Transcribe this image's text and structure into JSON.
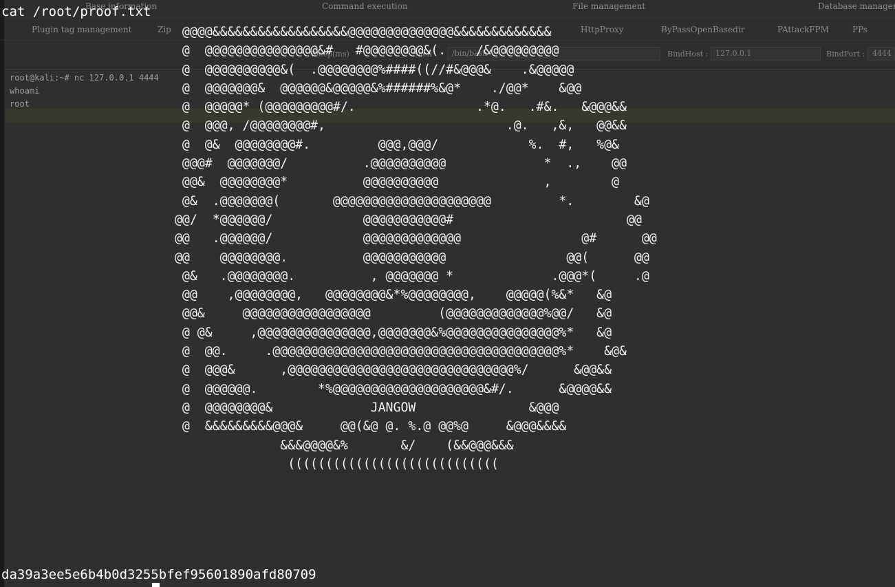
{
  "nav": {
    "row1": [
      "Base information",
      "Command execution",
      "File management",
      "Database management"
    ],
    "row2": [
      "Plugin tag management",
      "Zip",
      "HttpProxy",
      "ByPassOpenBasedir",
      "PAttackFPM",
      "PPs"
    ]
  },
  "options": {
    "sleep_label": "Sleep(ms)",
    "shell_label": "Shell",
    "shell_value": "/bin/bash",
    "bindhost_label": "BindHost :",
    "bindhost_value": "127.0.0.1",
    "bindport_label": "BindPort :",
    "bindport_value": "4444"
  },
  "console": {
    "lines": [
      "root@kali:~# nc 127.0.0.1 4444",
      "whoami",
      "root"
    ]
  },
  "terminal": {
    "command": "cat /root/proof.txt",
    "ascii_art": "  @@@@&&&&&&&&&&&&&&&&&&@@@@@@@@@@@@@@&&&&&&&&&&&&&\n  @  @@@@@@@@@@@@@@@&#   #@@@@@@@@&(.    /&@@@@@@@@@\n  @  @@@@@@@@@@&(  .@@@@@@@@%####((//#&@@@&    .&@@@@@\n  @  @@@@@@@&  @@@@@@&@@@@@&%######%&@*    ./@@*    &@@\n  @  @@@@@* (@@@@@@@@@#/.                .*@.   .#&.   &@@@&&\n  @  @@@, /@@@@@@@@#,                        .@.   ,&,   @@&&\n  @  @&  @@@@@@@@#.         @@@,@@@/            %.  #,   %@&\n  @@@#  @@@@@@@/          .@@@@@@@@@@             *  .,    @@\n  @@&  @@@@@@@@*          @@@@@@@@@@              ,        @\n  @&  .@@@@@@@(       @@@@@@@@@@@@@@@@@@@@@         *.        &@\n @@/  *@@@@@@/            @@@@@@@@@@@#                       @@\n @@   .@@@@@@/            @@@@@@@@@@@@@                @#      @@\n @@    @@@@@@@@.          @@@@@@@@@@@                @@(      @@\n  @&   .@@@@@@@@.          , @@@@@@@ *             .@@@*(     .@\n  @@    ,@@@@@@@@,   @@@@@@@@&*%@@@@@@@@,    @@@@@(%&*   &@\n  @@&     @@@@@@@@@@@@@@@@@         (@@@@@@@@@@@@@%@@/   &@\n  @ @&     ,@@@@@@@@@@@@@@@,@@@@@@@&%@@@@@@@@@@@@@@@%*   &@\n  @  @@.     .@@@@@@@@@@@@@@@@@@@@@@@@@@@@@@@@@@@@@@%*    &@&\n  @  @@@&      ,@@@@@@@@@@@@@@@@@@@@@@@@@@@@@@%/      &@@&&\n  @  @@@@@@.        *%@@@@@@@@@@@@@@@@@@@@&#/.      &@@@@&&\n  @  @@@@@@@@&             JANGOW               &@@@\n  @  &&&&&&&&&@@@&     @@(&@ @. %.@ @@%@     &@@@&&&&\n               &&&@@@@&%       &/    (&&@@@&&&\n                ((((((((((((((((((((((((((((",
    "hash": "da39a3ee5e6b4b0d3255bfef95601890afd80709"
  }
}
